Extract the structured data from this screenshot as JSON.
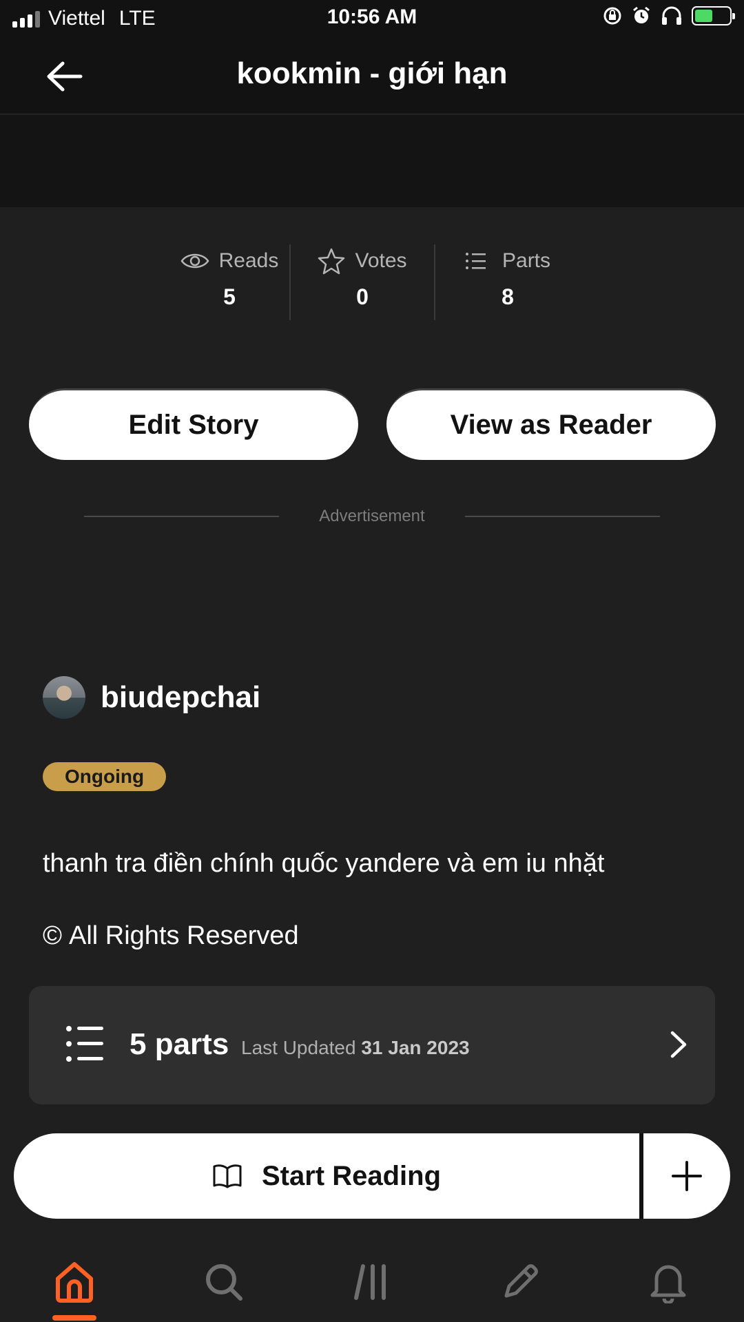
{
  "status_bar": {
    "carrier": "Viettel",
    "network": "LTE",
    "time": "10:56 AM"
  },
  "header": {
    "title": "kookmin - giới hạn"
  },
  "stats": [
    {
      "label": "Reads",
      "value": "5",
      "icon": "eye-icon"
    },
    {
      "label": "Votes",
      "value": "0",
      "icon": "star-icon"
    },
    {
      "label": "Parts",
      "value": "8",
      "icon": "list-icon"
    }
  ],
  "actions": {
    "edit_label": "Edit Story",
    "reader_label": "View as Reader"
  },
  "advertisement_label": "Advertisement",
  "author": {
    "name": "biudepchai"
  },
  "status_badge": "Ongoing",
  "description": "thanh tra điền chính quốc yandere và em iu nhặt",
  "copyright": {
    "symbol": "©",
    "text": "All Rights Reserved"
  },
  "parts_card": {
    "count": "5 parts",
    "updated_prefix": "Last Updated",
    "updated_date": "31 Jan 2023"
  },
  "start_reading_label": "Start Reading",
  "bottom_nav": [
    {
      "name": "home",
      "icon": "home-icon",
      "active": true
    },
    {
      "name": "search",
      "icon": "search-icon",
      "active": false
    },
    {
      "name": "library",
      "icon": "library-icon",
      "active": false
    },
    {
      "name": "write",
      "icon": "pencil-icon",
      "active": false
    },
    {
      "name": "notifications",
      "icon": "bell-icon",
      "active": false
    }
  ],
  "colors": {
    "background": "#1f1f1f",
    "accent": "#ff6122",
    "badge": "#c89e4a",
    "battery": "#4cd964"
  }
}
